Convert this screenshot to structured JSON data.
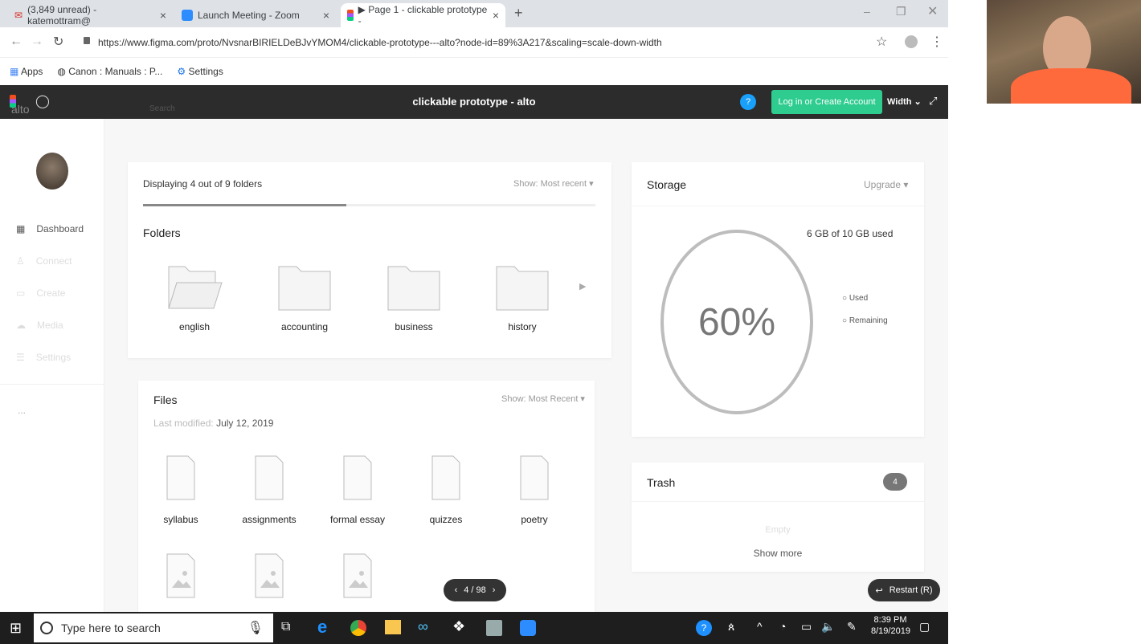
{
  "browser": {
    "tabs": [
      {
        "label": "(3,849 unread) - katemottram@"
      },
      {
        "label": "Launch Meeting - Zoom"
      },
      {
        "label": "▶ Page 1 - clickable prototype -"
      }
    ],
    "url": "https://www.figma.com/proto/NvsnarBIRIELDeBJvYMOM4/clickable-prototype---alto?node-id=89%3A217&scaling=scale-down-width",
    "bookmarks": [
      "Apps",
      "Canon : Manuals : P...",
      "Settings"
    ]
  },
  "figma": {
    "brand": "alto",
    "search_placeholder": "Search",
    "title": "clickable prototype - alto",
    "help": "?",
    "login_label": "Log in or Create Account",
    "width_label": "Width",
    "page_counter": "4 / 98",
    "restart_label": "Restart (R)"
  },
  "sidebar": {
    "items": [
      {
        "label": "Dashboard"
      },
      {
        "label": "Connect"
      },
      {
        "label": "Create"
      },
      {
        "label": "Media"
      },
      {
        "label": "Settings"
      }
    ],
    "more": "..."
  },
  "folders_card": {
    "displaying": "Displaying 4 out of 9 folders",
    "show": "Show: Most recent",
    "progress_fraction": 0.45,
    "title": "Folders",
    "folders": [
      "english",
      "accounting",
      "business",
      "history"
    ]
  },
  "files_card": {
    "title": "Files",
    "show": "Show: Most Recent",
    "last_modified_label": "Last modified:",
    "last_modified_date": "July 12, 2019",
    "files": [
      "syllabus",
      "assignments",
      "formal essay",
      "quizzes",
      "poetry"
    ]
  },
  "storage": {
    "title": "Storage",
    "upgrade": "Upgrade",
    "usage": "6 GB of 10 GB used",
    "percent": "60%",
    "legend": [
      "Used",
      "Remaining"
    ]
  },
  "trash": {
    "title": "Trash",
    "count": "4",
    "empty": "Empty",
    "show_more": "Show more"
  },
  "taskbar": {
    "search_placeholder": "Type here to search",
    "time": "8:39 PM",
    "date": "8/19/2019"
  }
}
